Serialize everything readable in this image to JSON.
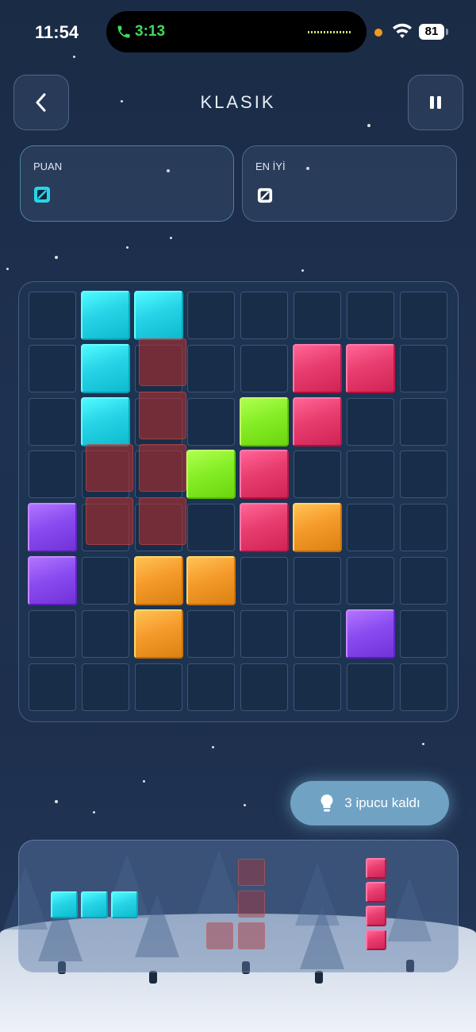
{
  "status_bar": {
    "time": "11:54",
    "call_time": "3:13",
    "battery": "81"
  },
  "header": {
    "title": "KLASIK",
    "back_icon": "chevron-left-icon",
    "pause_icon": "pause-icon"
  },
  "scores": {
    "puan_label": "PUAN",
    "puan_icon": "score-icon",
    "best_label": "EN İYİ",
    "best_icon": "best-score-icon"
  },
  "colors": {
    "cyan": "#27d3e6",
    "red": "#e83d6e",
    "green": "#86ee27",
    "purple": "#8a4cf0",
    "orange": "#f59b2c",
    "ghost": "#b22f2f"
  },
  "board": {
    "rows": 8,
    "cols": 8,
    "blocks": [
      {
        "r": 0,
        "c": 1,
        "color": "cyan"
      },
      {
        "r": 0,
        "c": 2,
        "color": "cyan"
      },
      {
        "r": 1,
        "c": 1,
        "color": "cyan"
      },
      {
        "r": 2,
        "c": 1,
        "color": "cyan"
      },
      {
        "r": 1,
        "c": 5,
        "color": "red"
      },
      {
        "r": 1,
        "c": 6,
        "color": "red"
      },
      {
        "r": 2,
        "c": 5,
        "color": "red"
      },
      {
        "r": 3,
        "c": 4,
        "color": "red"
      },
      {
        "r": 4,
        "c": 4,
        "color": "red"
      },
      {
        "r": 2,
        "c": 4,
        "color": "green"
      },
      {
        "r": 3,
        "c": 3,
        "color": "green"
      },
      {
        "r": 4,
        "c": 0,
        "color": "purple"
      },
      {
        "r": 5,
        "c": 0,
        "color": "purple"
      },
      {
        "r": 6,
        "c": 6,
        "color": "purple"
      },
      {
        "r": 4,
        "c": 5,
        "color": "orange"
      },
      {
        "r": 5,
        "c": 2,
        "color": "orange"
      },
      {
        "r": 5,
        "c": 3,
        "color": "orange"
      },
      {
        "r": 6,
        "c": 2,
        "color": "orange"
      }
    ],
    "ghost_blocks": [
      {
        "r": 1,
        "c": 2
      },
      {
        "r": 2,
        "c": 2
      },
      {
        "r": 3,
        "c": 1
      },
      {
        "r": 3,
        "c": 2
      },
      {
        "r": 4,
        "c": 1
      },
      {
        "r": 4,
        "c": 2
      }
    ]
  },
  "hint": {
    "label": "3 ipucu kaldı",
    "icon": "lightbulb-icon"
  },
  "tray": {
    "pieces": [
      {
        "name": "cyan-horizontal-3",
        "color": "cyan",
        "cells": [
          [
            0,
            0
          ],
          [
            0,
            1
          ],
          [
            0,
            2
          ]
        ]
      },
      {
        "name": "ghost-l-piece",
        "color": "ghost",
        "cells": [
          [
            0,
            1
          ],
          [
            1,
            1
          ],
          [
            2,
            0
          ],
          [
            2,
            1
          ]
        ]
      },
      {
        "name": "red-vertical-4",
        "color": "red",
        "cells": [
          [
            0,
            0
          ],
          [
            1,
            0
          ],
          [
            2,
            0
          ],
          [
            3,
            0
          ]
        ]
      }
    ]
  }
}
